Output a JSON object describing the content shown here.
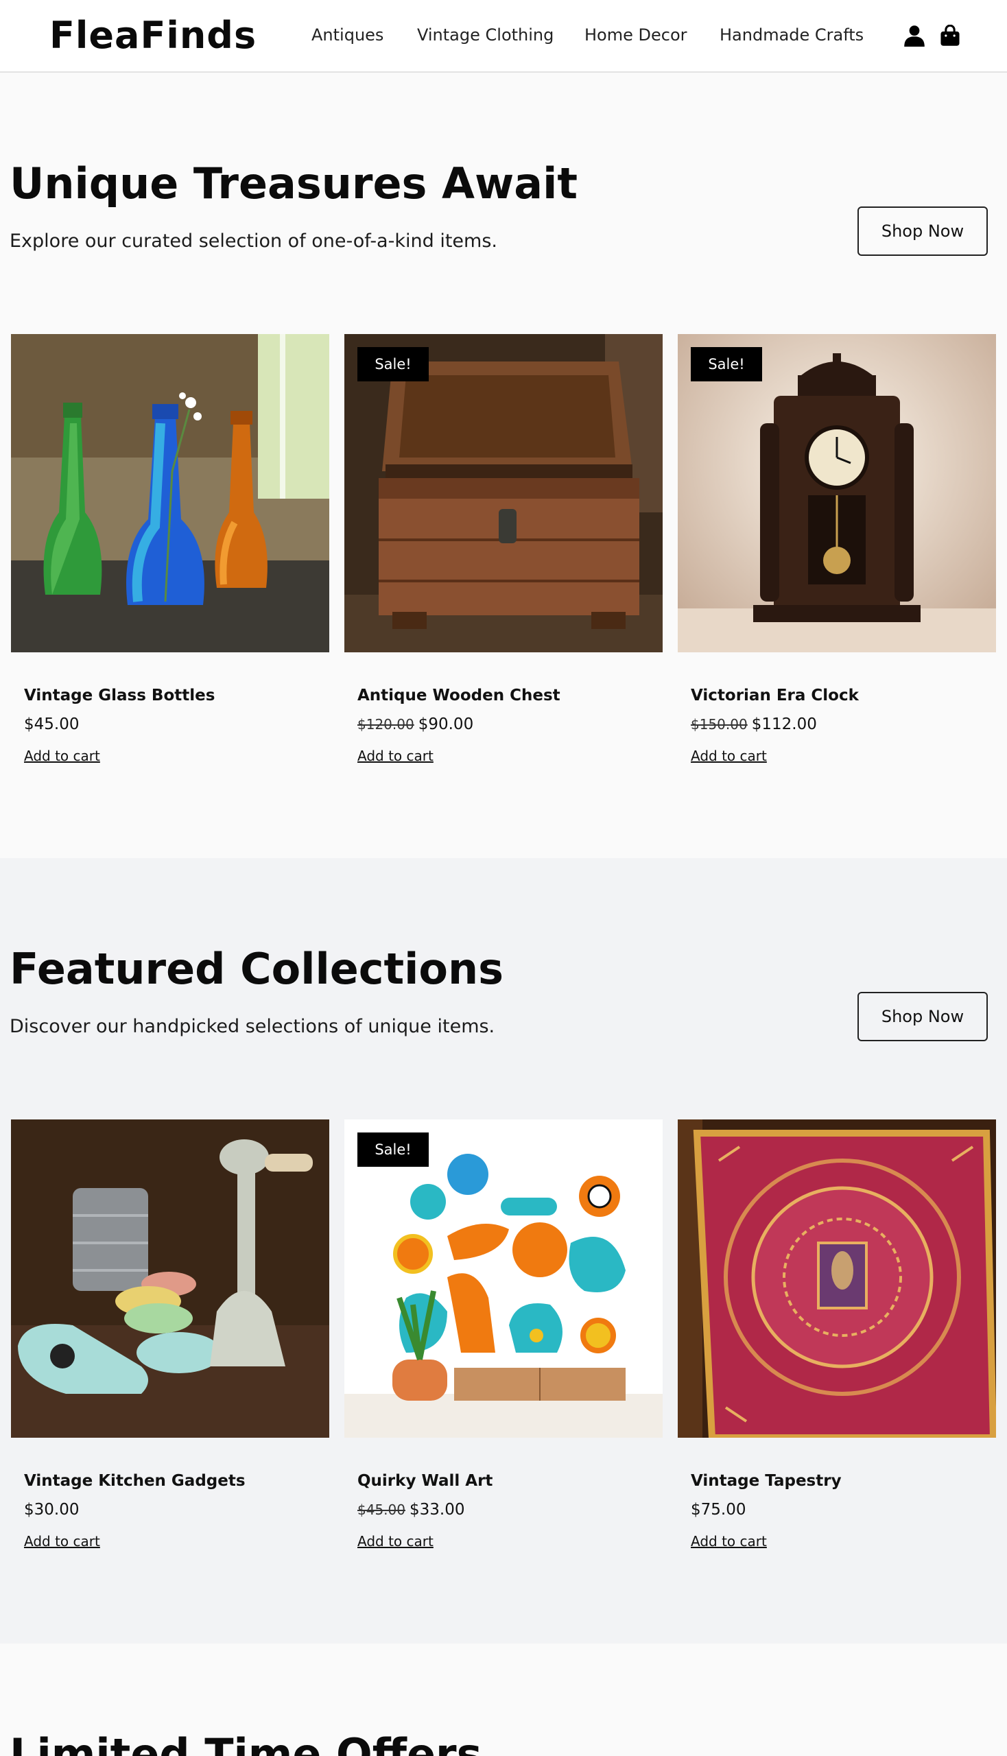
{
  "brand": {
    "logo_text": "FleaFinds"
  },
  "nav": {
    "items": [
      {
        "label": "Antiques"
      },
      {
        "label": "Vintage Clothing"
      },
      {
        "label": "Home Decor"
      },
      {
        "label": "Handmade Crafts"
      }
    ],
    "icons": [
      "user-icon",
      "shopping-bag-icon"
    ]
  },
  "hero": {
    "title": "Unique Treasures Await",
    "subtitle": "Explore our curated selection of one-of-a-kind items.",
    "button_label": "Shop Now",
    "products": [
      {
        "name": "Vintage Glass Bottles",
        "price": "$45.00",
        "old_price": "",
        "sale": false,
        "cta": "Add to cart"
      },
      {
        "name": "Antique Wooden Chest",
        "price": "$90.00",
        "old_price": "$120.00",
        "sale": true,
        "badge": "Sale!",
        "cta": "Add to cart"
      },
      {
        "name": "Victorian Era Clock",
        "price": "$112.00",
        "old_price": "$150.00",
        "sale": true,
        "badge": "Sale!",
        "cta": "Add to cart"
      }
    ]
  },
  "featured": {
    "title": "Featured Collections",
    "subtitle": "Discover our handpicked selections of unique items.",
    "button_label": "Shop Now",
    "products": [
      {
        "name": "Vintage Kitchen Gadgets",
        "price": "$30.00",
        "old_price": "",
        "sale": false,
        "cta": "Add to cart"
      },
      {
        "name": "Quirky Wall Art",
        "price": "$33.00",
        "old_price": "$45.00",
        "sale": true,
        "badge": "Sale!",
        "cta": "Add to cart"
      },
      {
        "name": "Vintage Tapestry",
        "price": "$75.00",
        "old_price": "",
        "sale": false,
        "cta": "Add to cart"
      }
    ]
  },
  "limited": {
    "title": "Limited Time Offers"
  },
  "colors": {
    "header_bg": "#ffffff",
    "page_bg": "#fafafa",
    "featured_bg": "#f2f3f5",
    "badge_bg": "#000000",
    "text": "#111111"
  }
}
